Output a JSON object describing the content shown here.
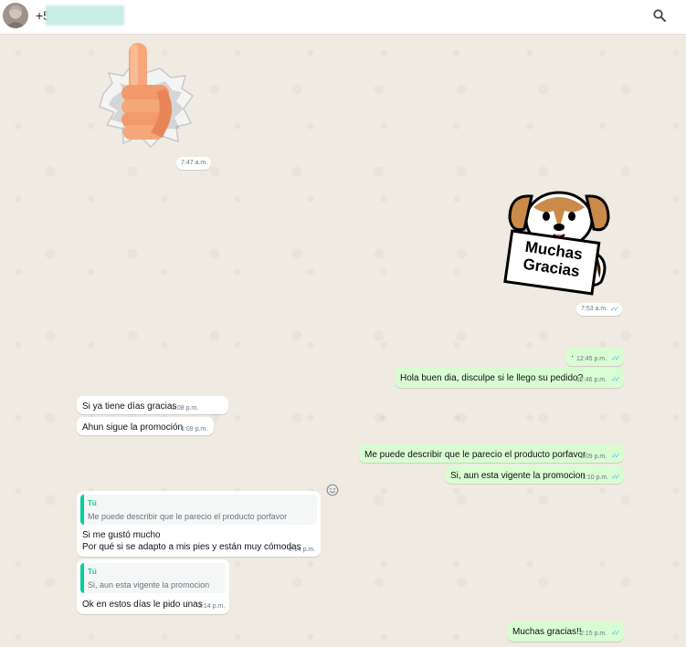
{
  "header": {
    "contact_name": "+5",
    "search_icon": "search-icon"
  },
  "colors": {
    "incoming_bubble": "#ffffff",
    "outgoing_bubble": "#d9fdd3",
    "read_ticks": "#53bdeb",
    "quote_accent": "#06cf9c",
    "chat_background": "#efeae2"
  },
  "messages": {
    "sticker_thumb": {
      "sticker": "thumbs-up",
      "time": "7:47 a.m."
    },
    "sticker_dog": {
      "sticker": "dog-muchas-gracias",
      "text": "Muchas Gracias",
      "time": "7:53 a.m."
    },
    "m1": {
      "text": "·",
      "time": "12:45 p.m."
    },
    "m2": {
      "text": "Hola buen dia, disculpe si le llego su pedido?",
      "time": "12:46 p.m."
    },
    "m3": {
      "text": "Si ya tiene días gracias",
      "time": "1:08 p.m."
    },
    "m4": {
      "text": "Ahun sigue la promoción",
      "time": "1:09 p.m."
    },
    "m5": {
      "text": "Me puede describir que le parecio el producto porfavor",
      "time": "1:09 p.m."
    },
    "m6": {
      "text": "Si, aun esta vigente la promocion",
      "time": "1:10 p.m."
    },
    "m7": {
      "quote_author": "Tú",
      "quote_text": "Me puede describir que le parecio el producto porfavor",
      "line1": "Si me gustó mucho",
      "line2": "Por qué si se adapto a mis pies y están muy cómodas",
      "time": "2:14 p.m."
    },
    "m8": {
      "quote_author": "Tú",
      "quote_text": "Si, aun esta vigente la promocion",
      "text": "Ok en estos días le pido unas",
      "time": "2:14 p.m."
    },
    "m9": {
      "text": "Muchas gracias!!",
      "time": "2:15 p.m."
    }
  }
}
